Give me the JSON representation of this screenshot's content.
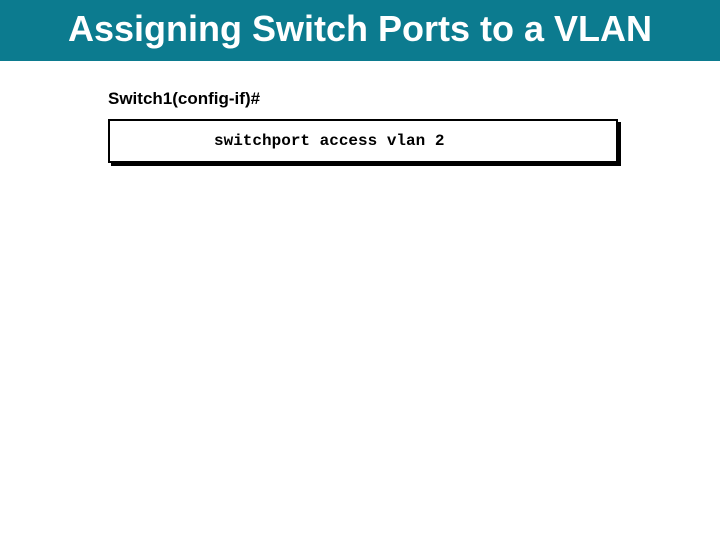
{
  "slide": {
    "title": "Assigning Switch Ports to a VLAN",
    "prompt": "Switch1(config-if)#",
    "command": "switchport access vlan 2"
  }
}
